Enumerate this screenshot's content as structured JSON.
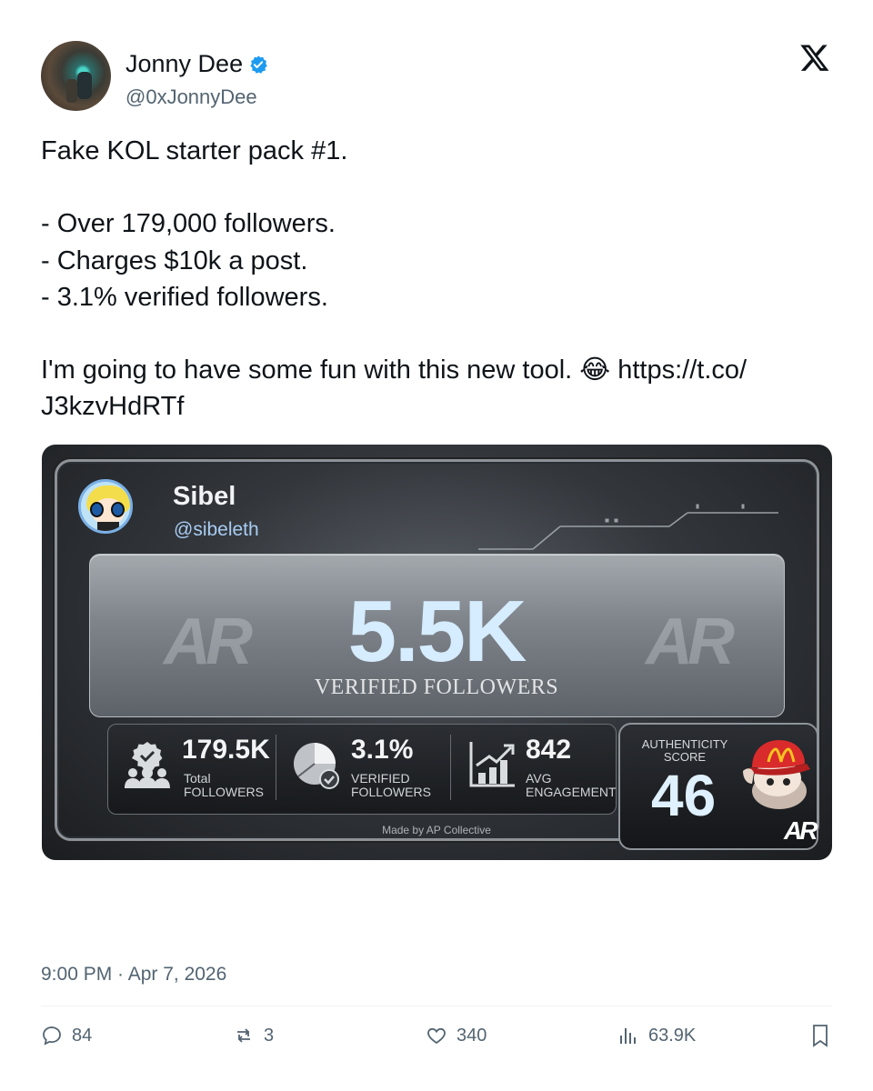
{
  "author": {
    "name": "Jonny Dee",
    "handle": "@0xJonnyDee",
    "verified": true,
    "avatar_icon": "avatar-photo"
  },
  "platform_icon": "x-logo-icon",
  "tweet": {
    "lines": [
      "Fake KOL starter pack #1.",
      "",
      "- Over 179,000 followers.",
      "- Charges $10k a post.",
      "- 3.1% verified followers.",
      "",
      "I'm going to have some fun with this new tool. 😂 https://t.co/",
      "J3kzvHdRTf"
    ]
  },
  "card": {
    "name": "Sibel",
    "handle": "@sibeleth",
    "watermark": "AR",
    "big_value": "5.5K",
    "big_label": "VERIFIED FOLLOWERS",
    "stats": [
      {
        "value": "179.5K",
        "label_line1": "Total",
        "label_line2": "FOLLOWERS",
        "icon": "users-verified-icon"
      },
      {
        "value": "3.1%",
        "label_line1": "VERIFIED",
        "label_line2": "FOLLOWERS",
        "icon": "pie-check-icon"
      },
      {
        "value": "842",
        "label_line1": "AVG",
        "label_line2": "ENGAGEMENT",
        "icon": "bar-chart-up-icon"
      }
    ],
    "score_label_line1": "AUTHENTICITY",
    "score_label_line2": "SCORE",
    "score_value": "46",
    "made_by": "Made by AP Collective",
    "corner_logo": "AR",
    "accent_color": "#d6ecff"
  },
  "timestamp": "9:00 PM · Apr 7, 2026",
  "actions": {
    "replies": "84",
    "reposts": "3",
    "likes": "340",
    "views": "63.9K"
  }
}
